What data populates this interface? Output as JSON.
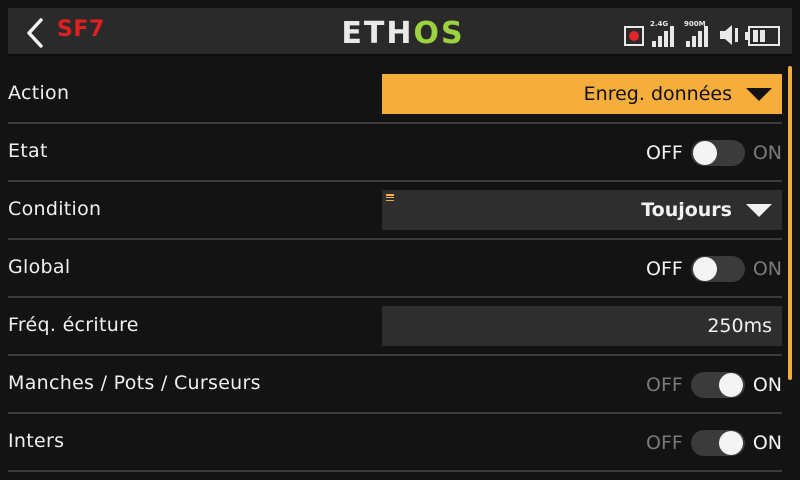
{
  "header": {
    "page_code": "SF7",
    "logo_part1": "ETH",
    "logo_part2": "OS",
    "signal_1_label": "2.4G",
    "signal_2_label": "900M"
  },
  "colors": {
    "accent": "#f5ad3c",
    "page_code": "#e02020",
    "logo_os": "#9ed13f",
    "record": "#e3242b"
  },
  "icons": {
    "back": "chevron-left-icon",
    "record": "record-icon",
    "signal": "signal-bars-icon",
    "speaker": "speaker-icon",
    "battery": "battery-icon",
    "menu": "menu-icon",
    "dropdown": "triangle-down-icon"
  },
  "rows": [
    {
      "label": "Action",
      "value": "Enreg. données"
    },
    {
      "label": "Etat",
      "off_label": "OFF",
      "on_label": "ON",
      "state": "off"
    },
    {
      "label": "Condition",
      "value": "Toujours"
    },
    {
      "label": "Global",
      "off_label": "OFF",
      "on_label": "ON",
      "state": "off"
    },
    {
      "label": "Fréq. écriture",
      "value": "250ms"
    },
    {
      "label": "Manches / Pots / Curseurs",
      "off_label": "OFF",
      "on_label": "ON",
      "state": "on"
    },
    {
      "label": "Inters",
      "off_label": "OFF",
      "on_label": "ON",
      "state": "on"
    }
  ]
}
